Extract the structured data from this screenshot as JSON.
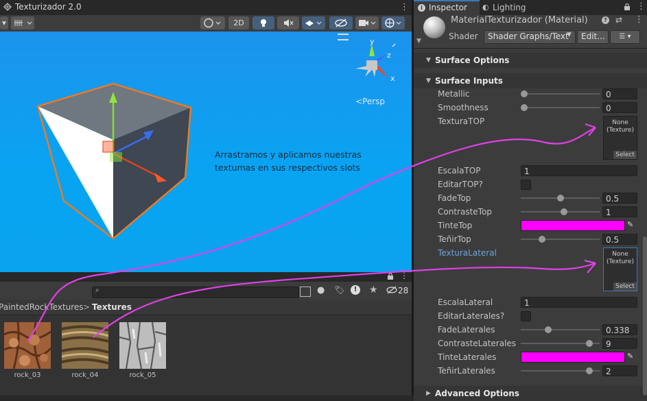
{
  "scene": {
    "title": "Texturizador 2.0",
    "toolbar": {
      "mode_2d": "2D"
    },
    "persp_label": "<Persp",
    "gizmo_axes": {
      "y": "y",
      "z": "z",
      "x": "x"
    },
    "annotation": "Arrastramos y aplicamos nuestras\ntextumas en sus respectivos slots"
  },
  "project": {
    "search_placeholder": "",
    "hidden_count": "28",
    "breadcrumb": {
      "parent": "PaintedRockTextures",
      "separator": ">",
      "current": "Textures"
    },
    "assets": [
      {
        "name": "rock_03"
      },
      {
        "name": "rock_04"
      },
      {
        "name": "rock_05"
      }
    ]
  },
  "inspector": {
    "tabs": [
      {
        "label": "Inspector",
        "icon": "info-icon"
      },
      {
        "label": "Lighting",
        "icon": "lightbulb-icon"
      }
    ],
    "material": {
      "name": "MaterialTexturizador (Material)",
      "shader_label": "Shader",
      "shader_value": "Shader Graphs/Text",
      "edit_label": "Edit..."
    },
    "sections": {
      "surface_options": "Surface Options",
      "surface_inputs": "Surface Inputs",
      "advanced_options": "Advanced Options"
    },
    "props": {
      "metallic": {
        "label": "Metallic",
        "value": "0",
        "fraction": 0.0
      },
      "smoothness": {
        "label": "Smoothness",
        "value": "0",
        "fraction": 0.0
      },
      "textura_top": {
        "label": "TexturaTOP",
        "none": "None\n(Texture)",
        "select": "Select"
      },
      "escala_top": {
        "label": "EscalaTOP",
        "value": "1"
      },
      "editar_top": {
        "label": "EditarTOP?"
      },
      "fade_top": {
        "label": "FadeTop",
        "value": "0.5",
        "fraction": 0.5
      },
      "contraste_top": {
        "label": "ContrasteTop",
        "value": "1",
        "fraction": 0.55
      },
      "tinte_top": {
        "label": "TinteTop",
        "color": "#ff00ff"
      },
      "tenir_top": {
        "label": "TeñirTop",
        "value": "0.5",
        "fraction": 0.25
      },
      "textura_lateral": {
        "label": "TexturaLateral",
        "none": "None\n(Texture)",
        "select": "Select"
      },
      "escala_lateral": {
        "label": "EscalaLateral",
        "value": "1"
      },
      "editar_laterales": {
        "label": "EditarLaterales?"
      },
      "fade_laterales": {
        "label": "FadeLaterales",
        "value": "0.338",
        "fraction": 0.338
      },
      "contraste_laterales": {
        "label": "ContrasteLaterales",
        "value": "9",
        "fraction": 0.9
      },
      "tinte_laterales": {
        "label": "TinteLaterales",
        "color": "#ff00ff"
      },
      "tenir_laterales": {
        "label": "TeñirLaterales",
        "value": "2",
        "fraction": 0.9
      }
    }
  }
}
